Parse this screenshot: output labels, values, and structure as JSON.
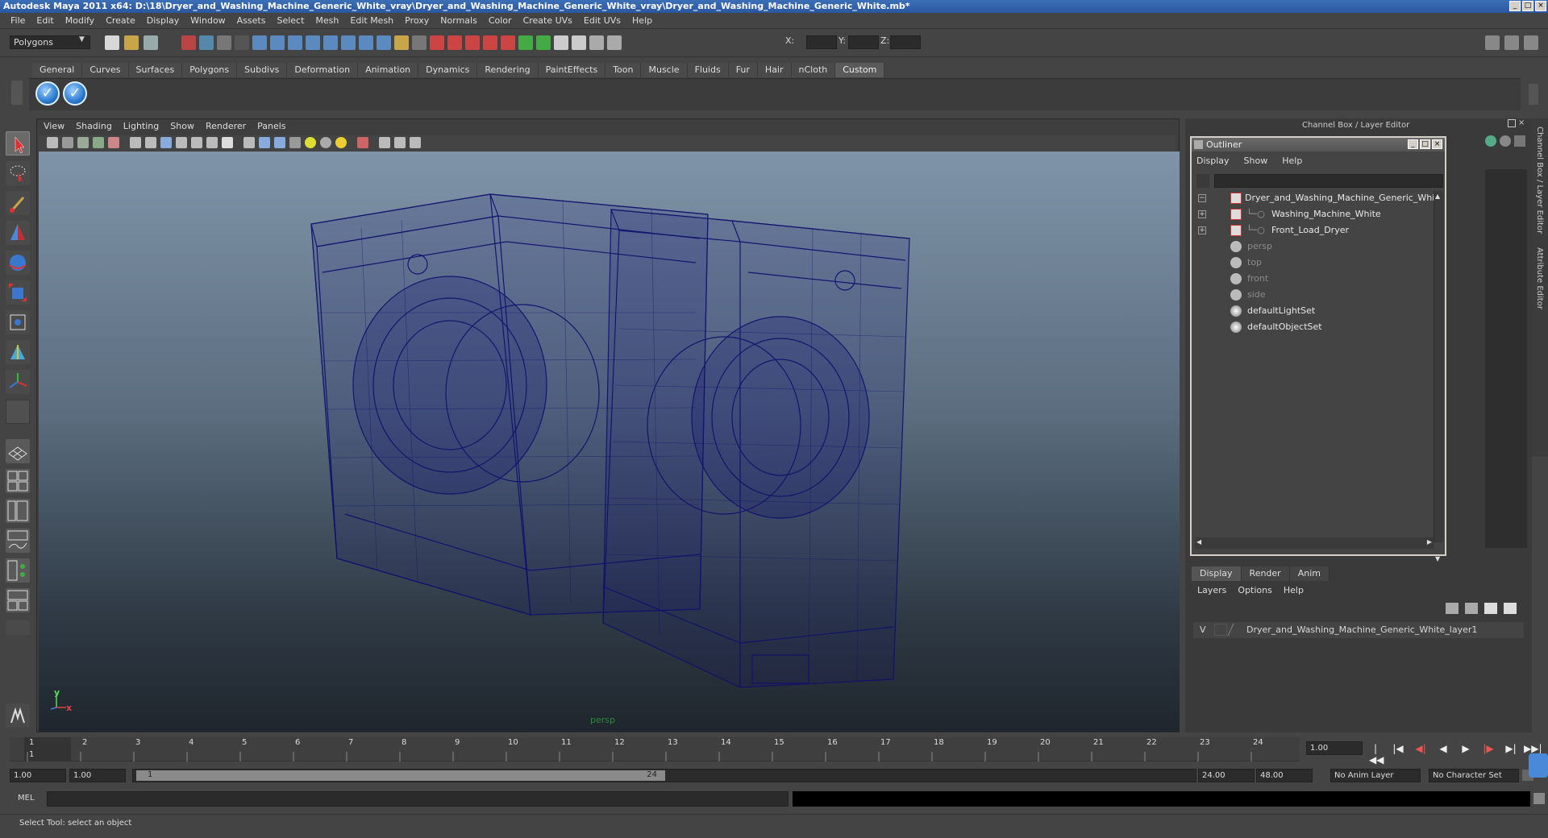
{
  "window": {
    "title": "Autodesk Maya 2011 x64: D:\\18\\Dryer_and_Washing_Machine_Generic_White_vray\\Dryer_and_Washing_Machine_Generic_White_vray\\Dryer_and_Washing_Machine_Generic_White.mb*",
    "buttons": [
      "_",
      "□",
      "×"
    ]
  },
  "menubar": [
    "File",
    "Edit",
    "Modify",
    "Create",
    "Display",
    "Window",
    "Assets",
    "Select",
    "Mesh",
    "Edit Mesh",
    "Proxy",
    "Normals",
    "Color",
    "Create UVs",
    "Edit UVs",
    "Help"
  ],
  "statusline": {
    "mode": "Polygons",
    "coord_labels": [
      "X:",
      "Y:",
      "Z:"
    ]
  },
  "shelf": {
    "tabs": [
      "General",
      "Curves",
      "Surfaces",
      "Polygons",
      "Subdivs",
      "Deformation",
      "Animation",
      "Dynamics",
      "Rendering",
      "PaintEffects",
      "Toon",
      "Muscle",
      "Fluids",
      "Fur",
      "Hair",
      "nCloth",
      "Custom"
    ],
    "active_tab": "Custom",
    "buttons": [
      "✓",
      "✓"
    ]
  },
  "viewport": {
    "menu": [
      "View",
      "Shading",
      "Lighting",
      "Show",
      "Renderer",
      "Panels"
    ],
    "camera_label": "persp",
    "axis_y": "y",
    "axis_x": "x",
    "wire_color": "#10106e"
  },
  "channel_box": {
    "title": "Channel Box / Layer Editor",
    "side_tabs": [
      "Channel Box / Layer Editor",
      "Attribute Editor"
    ]
  },
  "outliner": {
    "title": "Outliner",
    "menu": [
      "Display",
      "Show",
      "Help"
    ],
    "items": [
      {
        "label": "Dryer_and_Washing_Machine_Generic_White",
        "expander": "−"
      },
      {
        "label": "Washing_Machine_White",
        "expander": "+"
      },
      {
        "label": "Front_Load_Dryer",
        "expander": "+"
      },
      {
        "label": "persp"
      },
      {
        "label": "top"
      },
      {
        "label": "front"
      },
      {
        "label": "side"
      },
      {
        "label": "defaultLightSet"
      },
      {
        "label": "defaultObjectSet"
      }
    ]
  },
  "layers": {
    "tabs": [
      "Display",
      "Render",
      "Anim"
    ],
    "active_tab": "Display",
    "menu": [
      "Layers",
      "Options",
      "Help"
    ],
    "row": {
      "visible": "V",
      "name": "Dryer_and_Washing_Machine_Generic_White_layer1"
    }
  },
  "timeline": {
    "ticks": [
      "1",
      "2",
      "3",
      "4",
      "5",
      "6",
      "7",
      "8",
      "9",
      "10",
      "11",
      "12",
      "13",
      "14",
      "15",
      "16",
      "17",
      "18",
      "19",
      "20",
      "21",
      "22",
      "23",
      "24"
    ],
    "current_frame": "1.00",
    "playback_buttons": [
      "|◀◀",
      "|◀",
      "◀|",
      "◀",
      "▶",
      "|▶",
      "▶|",
      "▶▶|"
    ]
  },
  "range": {
    "start": "1.00",
    "playback_start": "1.00",
    "slider_start": "1",
    "slider_end": "24",
    "playback_end": "24.00",
    "end": "48.00",
    "anim_layer": "No Anim Layer",
    "character_set": "No Character Set"
  },
  "command": {
    "label": "MEL"
  },
  "help_line": "Select Tool: select an object"
}
